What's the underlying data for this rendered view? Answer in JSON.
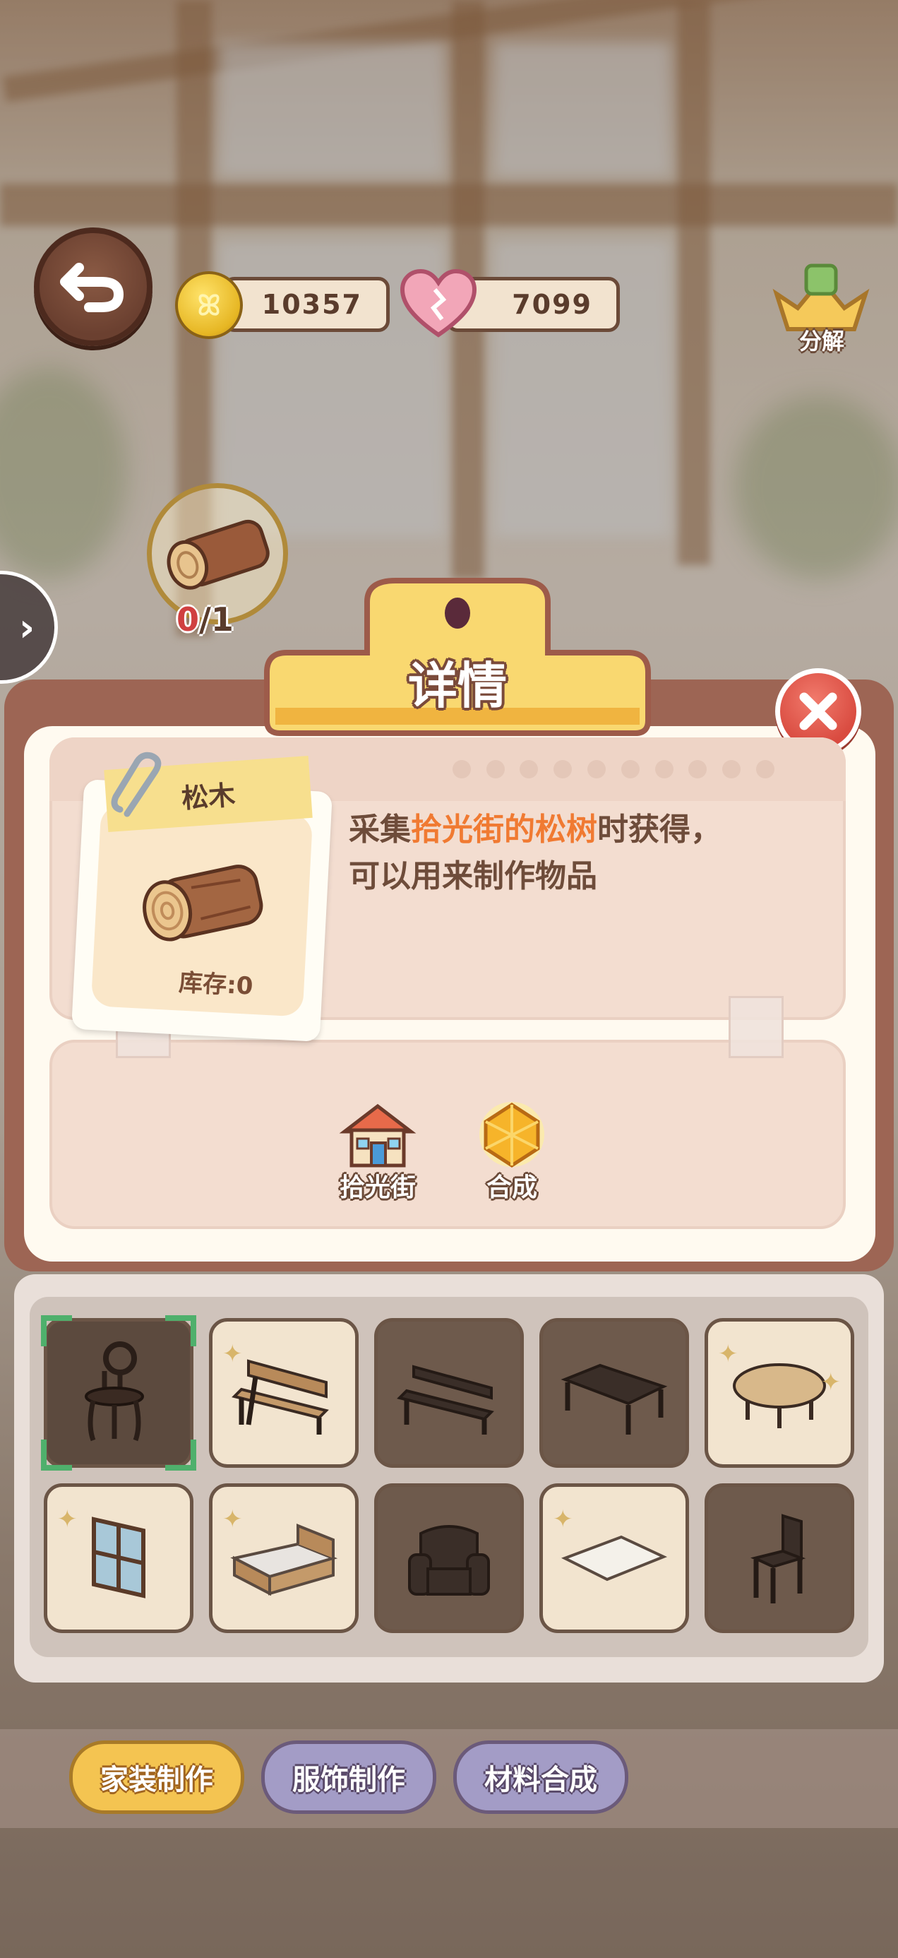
{
  "currencies": {
    "coins": "10357",
    "hearts": "7099"
  },
  "top": {
    "decompose_label": "分解"
  },
  "requirement": {
    "current": "0",
    "total": "/1"
  },
  "modal": {
    "title": "详情",
    "item_name": "松木",
    "stock_text": "库存:0",
    "description": {
      "prefix": "采集",
      "highlight": "拾光街的松树",
      "suffix": "时获得，",
      "line2": "可以用来制作物品"
    },
    "sources": [
      {
        "label": "拾光街",
        "icon": "house-icon"
      },
      {
        "label": "合成",
        "icon": "gem-icon"
      }
    ]
  },
  "furniture_grid": [
    {
      "icon": "chair-icon",
      "state": "selected"
    },
    {
      "icon": "bench-icon",
      "state": "unlocked"
    },
    {
      "icon": "bench-icon",
      "state": "locked"
    },
    {
      "icon": "table-icon",
      "state": "locked"
    },
    {
      "icon": "round-table-icon",
      "state": "unlocked"
    },
    {
      "icon": "window-icon",
      "state": "unlocked"
    },
    {
      "icon": "bed-icon",
      "state": "unlocked"
    },
    {
      "icon": "armchair-icon",
      "state": "locked"
    },
    {
      "icon": "rug-icon",
      "state": "unlocked"
    },
    {
      "icon": "chair-icon",
      "state": "locked"
    }
  ],
  "tabs": [
    {
      "label": "家装制作",
      "active": true
    },
    {
      "label": "服饰制作",
      "active": false
    },
    {
      "label": "材料合成",
      "active": false
    }
  ],
  "colors": {
    "highlight": "#f07a32",
    "modal_border": "#9d6554",
    "active_tab": "#f4c451",
    "inactive_tab": "#a39cc6",
    "close_red": "#d94b40"
  }
}
